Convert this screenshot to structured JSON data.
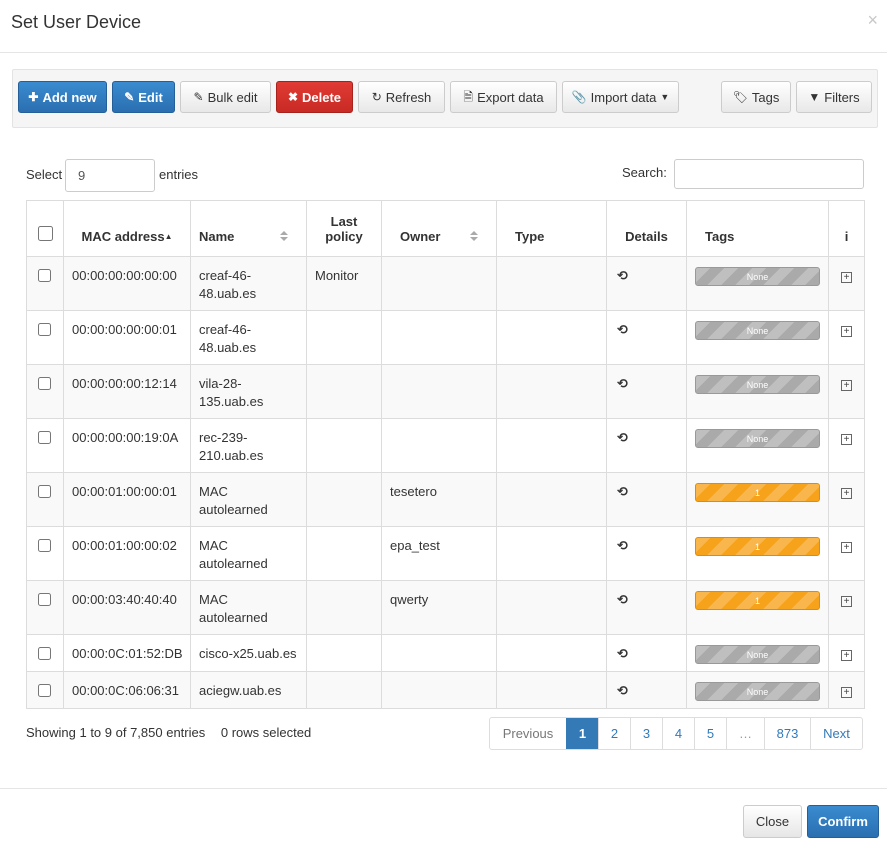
{
  "modal": {
    "title": "Set User Device",
    "close_glyph": "×"
  },
  "toolbar": {
    "add_new": "Add new",
    "edit": "Edit",
    "bulk_edit": "Bulk edit",
    "delete": "Delete",
    "refresh": "Refresh",
    "export_data": "Export data",
    "import_data": "Import data",
    "tags": "Tags",
    "filters": "Filters"
  },
  "length_control": {
    "prefix": "Select",
    "value": "9",
    "suffix": "entries"
  },
  "search": {
    "label": "Search:",
    "value": ""
  },
  "table": {
    "headers": {
      "mac": "MAC address",
      "name": "Name",
      "last_policy_1": "Last",
      "last_policy_2": "policy",
      "owner": "Owner",
      "type": "Type",
      "details": "Details",
      "tags": "Tags",
      "info": "i"
    },
    "rows": [
      {
        "mac": "00:00:00:00:00:00",
        "name_1": "creaf-46-",
        "name_2": "48.uab.es",
        "policy": "Monitor",
        "owner": "",
        "type": "",
        "tag": "None"
      },
      {
        "mac": "00:00:00:00:00:01",
        "name_1": "creaf-46-",
        "name_2": "48.uab.es",
        "policy": "",
        "owner": "",
        "type": "",
        "tag": "None"
      },
      {
        "mac": "00:00:00:00:12:14",
        "name_1": "vila-28-",
        "name_2": "135.uab.es",
        "policy": "",
        "owner": "",
        "type": "",
        "tag": "None"
      },
      {
        "mac": "00:00:00:00:19:0A",
        "name_1": "rec-239-",
        "name_2": "210.uab.es",
        "policy": "",
        "owner": "",
        "type": "",
        "tag": "None"
      },
      {
        "mac": "00:00:01:00:00:01",
        "name_1": "MAC",
        "name_2": "autolearned",
        "policy": "",
        "owner": "tesetero",
        "type": "",
        "tag": "1"
      },
      {
        "mac": "00:00:01:00:00:02",
        "name_1": "MAC",
        "name_2": "autolearned",
        "policy": "",
        "owner": "epa_test",
        "type": "",
        "tag": "1"
      },
      {
        "mac": "00:00:03:40:40:40",
        "name_1": "MAC",
        "name_2": "autolearned",
        "policy": "",
        "owner": "qwerty",
        "type": "",
        "tag": "1"
      },
      {
        "mac": "00:00:0C:01:52:DB",
        "name_1": "cisco-x25.uab.es",
        "name_2": "",
        "policy": "",
        "owner": "",
        "type": "",
        "tag": "None"
      },
      {
        "mac": "00:00:0C:06:06:31",
        "name_1": "aciegw.uab.es",
        "name_2": "",
        "policy": "",
        "owner": "",
        "type": "",
        "tag": "None"
      }
    ]
  },
  "status": {
    "showing": "Showing 1 to 9 of 7,850 entries",
    "selected": "0 rows selected"
  },
  "pagination": {
    "previous": "Previous",
    "p1": "1",
    "p2": "2",
    "p3": "3",
    "p4": "4",
    "p5": "5",
    "ellipsis": "…",
    "last": "873",
    "next": "Next"
  },
  "footer": {
    "close": "Close",
    "confirm": "Confirm"
  },
  "colors": {
    "primary": "#337ab7",
    "danger": "#d9352f",
    "tag_none": "#aaaaaa",
    "tag_active": "#f7a21b"
  },
  "icons": {
    "add": "plus-icon",
    "edit": "pencil-icon",
    "bulk": "pencil-icon",
    "delete": "times-icon",
    "refresh": "refresh-icon",
    "export": "file-icon",
    "import": "paperclip-icon",
    "tags": "tags-icon",
    "filters": "filter-icon",
    "details": "history-icon",
    "expand": "plus-square-icon"
  }
}
